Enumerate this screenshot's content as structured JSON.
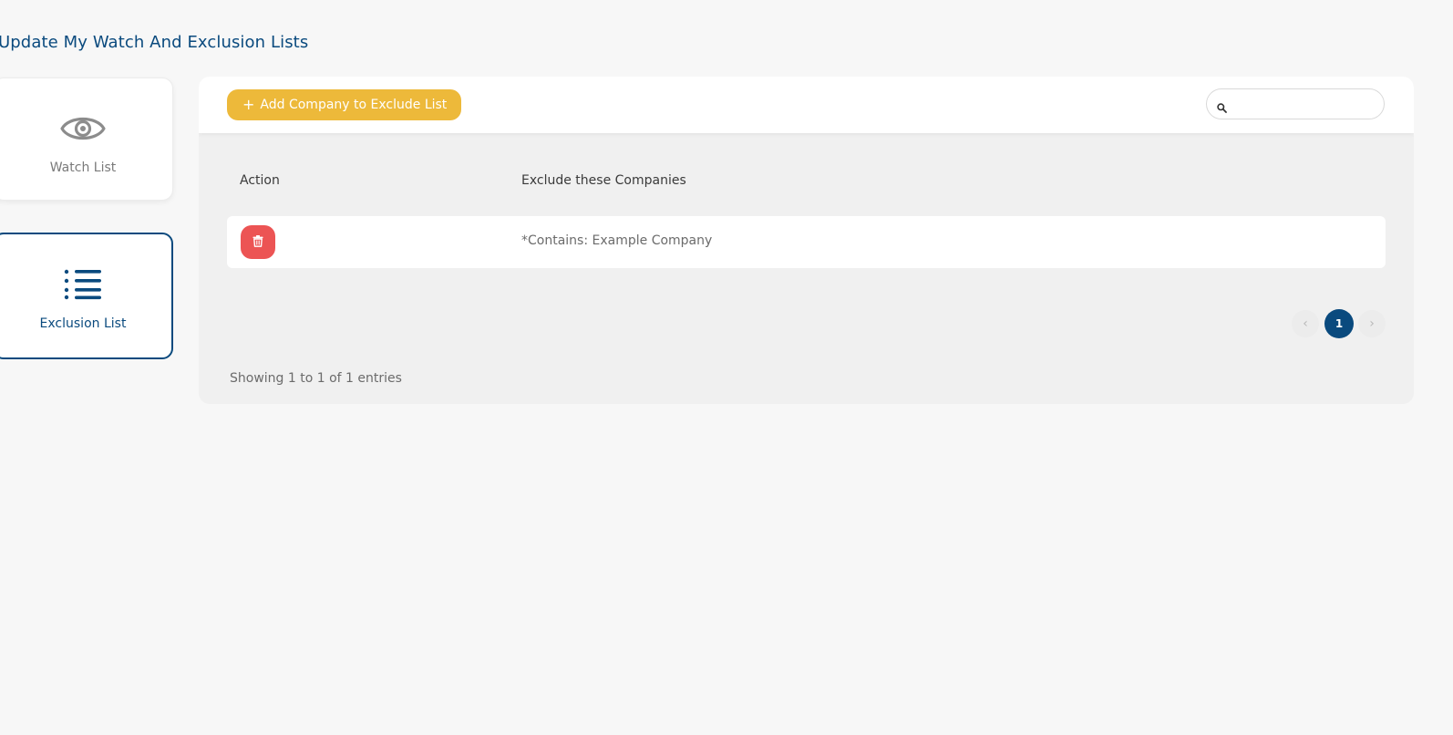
{
  "page": {
    "title": "Update My Watch And Exclusion Lists"
  },
  "nav": {
    "watch_list": {
      "label": "Watch List",
      "icon": "eye-icon"
    },
    "exclusion_list": {
      "label": "Exclusion List",
      "icon": "list-icon",
      "active": true
    }
  },
  "toolbar": {
    "add_button_label": "Add Company to Exclude List",
    "add_button_icon": "plus-icon",
    "search_icon": "search-icon",
    "search_value": "",
    "search_placeholder": ""
  },
  "table": {
    "columns": [
      "Action",
      "Exclude these Companies"
    ],
    "rows": [
      {
        "action_icon": "trash-icon",
        "company": "*Contains: Example Company"
      }
    ]
  },
  "pagination": {
    "prev_icon": "chevron-left-icon",
    "current_page": "1",
    "next_icon": "chevron-right-icon",
    "info": "Showing 1 to 1 of 1 entries"
  },
  "colors": {
    "brand_blue": "#0a4a7e",
    "add_button": "#edb93a",
    "delete_button": "#ec5454",
    "background": "#f7f7f7"
  }
}
